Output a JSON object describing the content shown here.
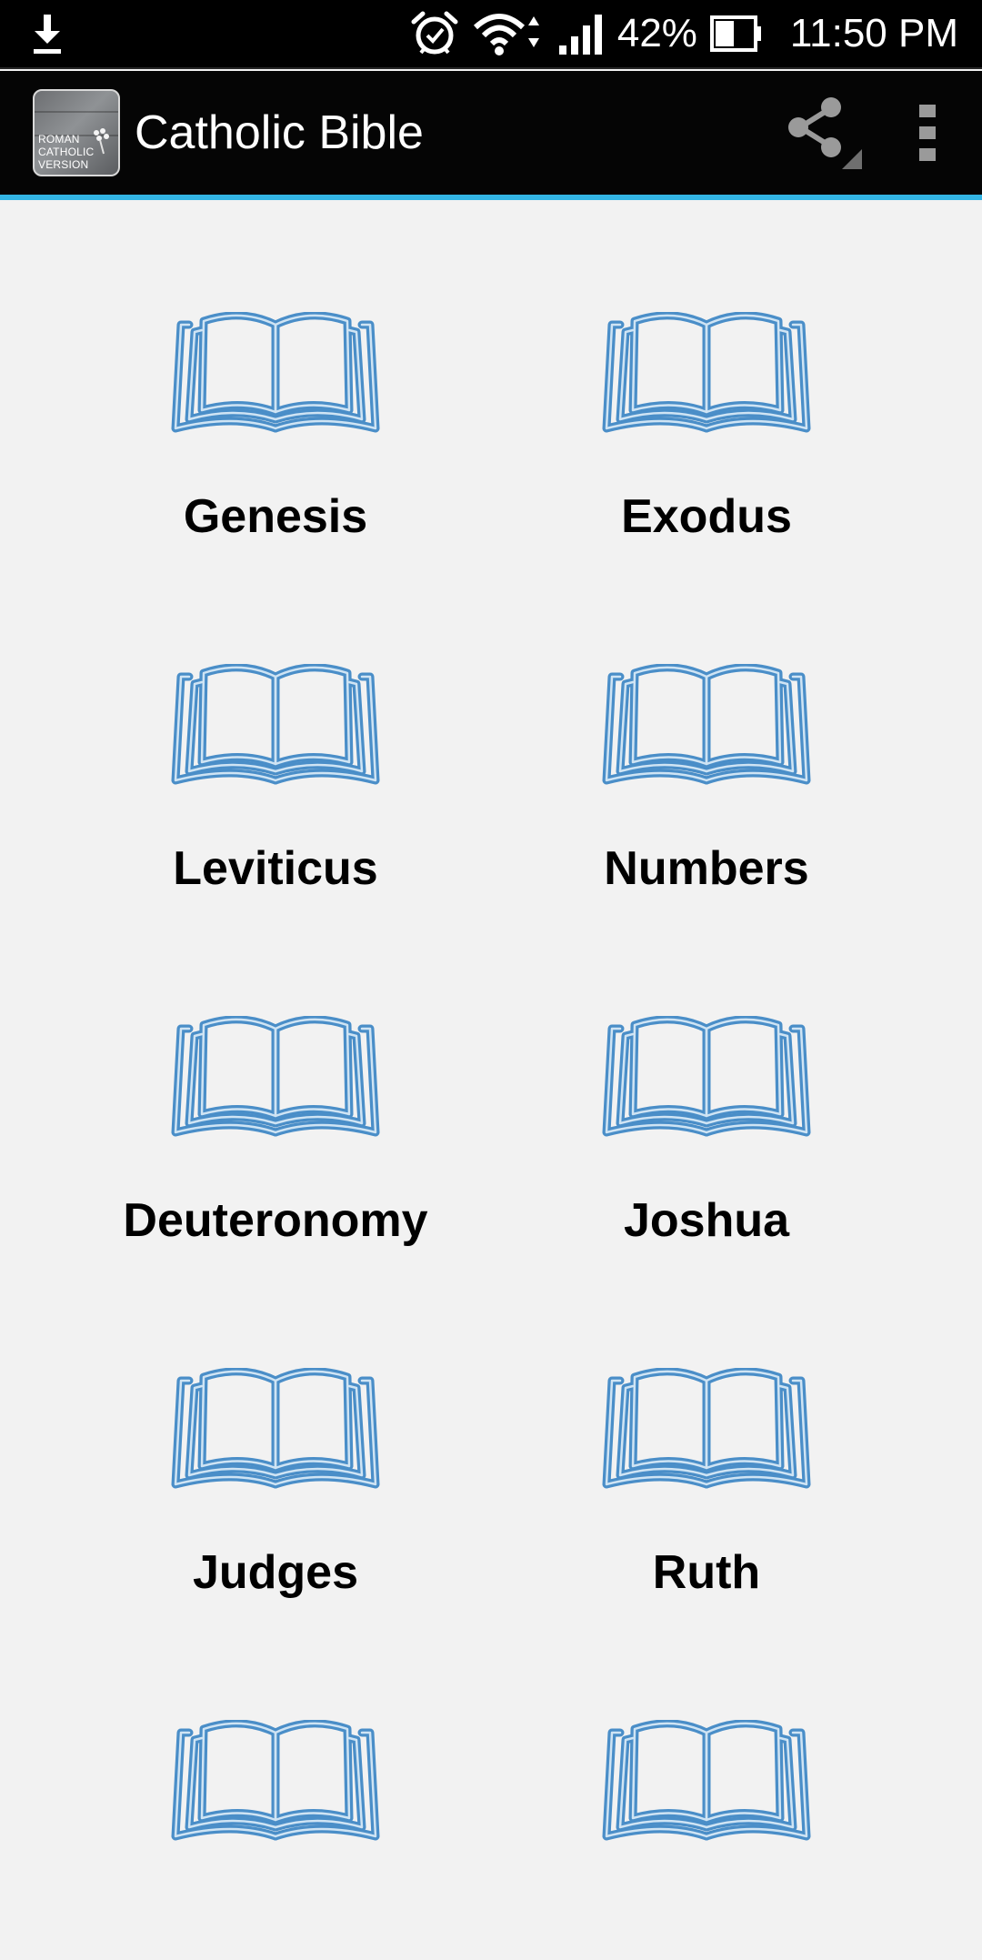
{
  "status_bar": {
    "battery": "42%",
    "time": "11:50 PM",
    "icons": [
      "download-icon",
      "alarm-icon",
      "wifi-icon",
      "signal-icon",
      "battery-icon"
    ]
  },
  "app_bar": {
    "title": "Catholic Bible",
    "app_icon_text": "ROMAN\nCATHOLIC\nVERSION",
    "icons": [
      "share-icon",
      "overflow-menu-icon"
    ]
  },
  "books": [
    {
      "label": "Genesis"
    },
    {
      "label": "Exodus"
    },
    {
      "label": "Leviticus"
    },
    {
      "label": "Numbers"
    },
    {
      "label": "Deuteronomy"
    },
    {
      "label": "Joshua"
    },
    {
      "label": "Judges"
    },
    {
      "label": "Ruth"
    },
    {
      "label": ""
    },
    {
      "label": ""
    }
  ],
  "colors": {
    "accent": "#33b5e5",
    "book_icon": "#4a8ec8",
    "background": "#f2f2f2"
  }
}
